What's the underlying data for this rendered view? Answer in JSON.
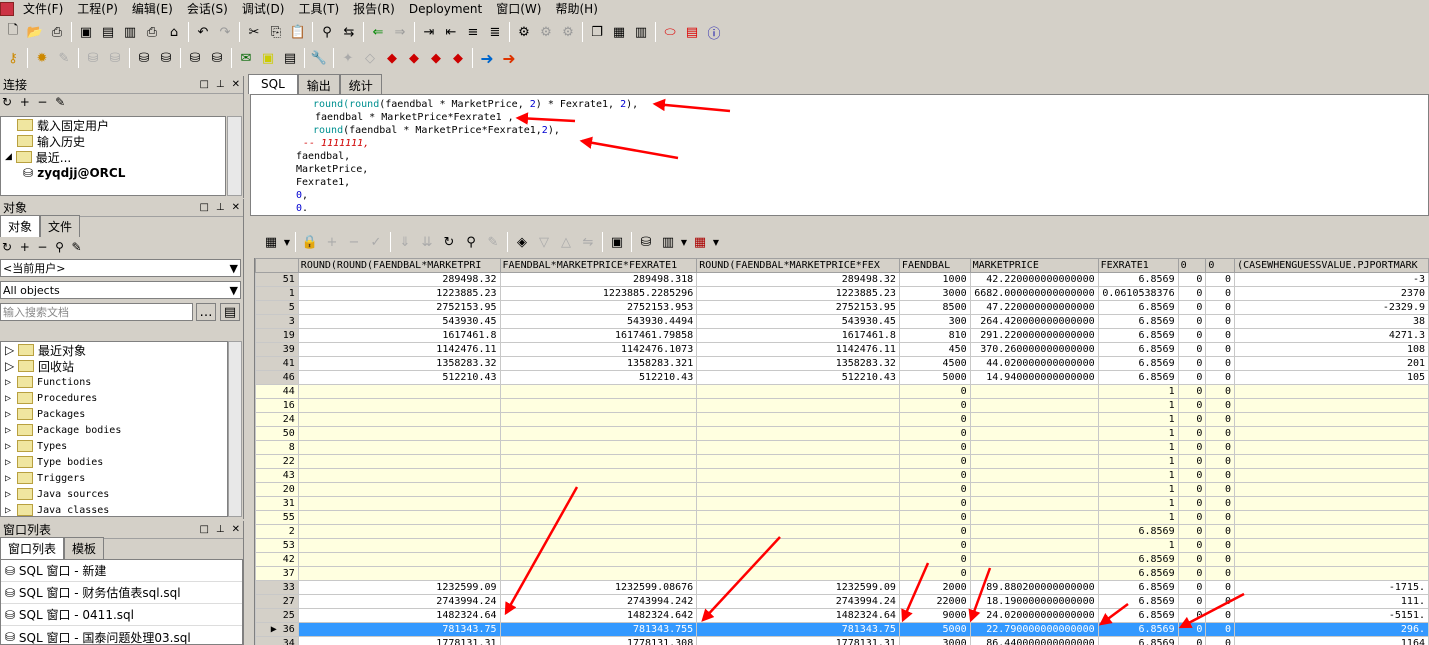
{
  "menu": [
    "文件(F)",
    "工程(P)",
    "编辑(E)",
    "会话(S)",
    "调试(D)",
    "工具(T)",
    "报告(R)",
    "Deployment",
    "窗口(W)",
    "帮助(H)"
  ],
  "connection": {
    "title": "连接",
    "items": [
      "载入固定用户",
      "输入历史",
      "最近...",
      "zyqdjj@ORCL"
    ]
  },
  "objects": {
    "title": "对象",
    "tabs": [
      "对象",
      "文件"
    ],
    "user_select": "<当前用户>",
    "filter_select": "All objects",
    "search_placeholder": "输入搜索文档",
    "items": [
      "最近对象",
      "回收站",
      "Functions",
      "Procedures",
      "Packages",
      "Package bodies",
      "Types",
      "Type bodies",
      "Triggers",
      "Java sources",
      "Java classes"
    ]
  },
  "windows": {
    "title": "窗口列表",
    "tabs": [
      "窗口列表",
      "模板"
    ],
    "items": [
      "SQL 窗口 - 新建",
      "SQL 窗口 - 财务估值表sql.sql",
      "SQL 窗口 - 0411.sql",
      "SQL 窗口 - 国泰问题处理03.sql"
    ]
  },
  "editor": {
    "tabs": [
      "SQL",
      "输出",
      "统计"
    ],
    "lines": [
      {
        "indent": "         ",
        "fn": "round(round",
        "rest": "(faendbal * MarketPrice, ",
        "n1": "2",
        "mid": ") * Fexrate1, ",
        "n2": "2",
        "end": "),"
      },
      {
        "indent": "         ",
        "fn": "",
        "rest": "faendbal * MarketPrice*Fexrate1 ,",
        "n1": "",
        "mid": "",
        "n2": "",
        "end": ""
      },
      {
        "indent": "         ",
        "fn": "round",
        "rest": "(faendbal * MarketPrice*Fexrate1,",
        "n1": "2",
        "mid": "),",
        "n2": "",
        "end": ""
      },
      {
        "indent": "      ",
        "comment": "-- 1111111,"
      },
      {
        "indent": "     ",
        "fn": "",
        "rest": "faendbal,",
        "n1": "",
        "mid": "",
        "n2": "",
        "end": ""
      },
      {
        "indent": "     ",
        "fn": "",
        "rest": "MarketPrice,",
        "n1": "",
        "mid": "",
        "n2": "",
        "end": ""
      },
      {
        "indent": "     ",
        "fn": "",
        "rest": "Fexrate1,",
        "n1": "",
        "mid": "",
        "n2": "",
        "end": ""
      },
      {
        "indent": "     ",
        "fn": "",
        "rest": "",
        "n1": "0",
        "mid": ",",
        "n2": "",
        "end": ""
      },
      {
        "indent": "     ",
        "fn": "",
        "rest": "",
        "n1": "0",
        "mid": ".",
        "n2": "",
        "end": ""
      }
    ]
  },
  "grid": {
    "columns": [
      "",
      "ROUND(ROUND(FAENDBAL*MARKETPRI",
      "FAENDBAL*MARKETPRICE*FEXRATE1",
      "ROUND(FAENDBAL*MARKETPRICE*FEX",
      "FAENDBAL",
      "MARKETPRICE",
      "FEXRATE1",
      "0",
      "0",
      "(CASEWHENGUESSVALUE.PJPORTMARK"
    ],
    "rows": [
      [
        "51",
        "289498.32",
        "289498.318",
        "289498.32",
        "1000",
        "42.220000000000000",
        "6.8569",
        "0",
        "0",
        "-3"
      ],
      [
        "1",
        "1223885.23",
        "1223885.2285296",
        "1223885.23",
        "3000",
        "6682.000000000000000",
        "0.0610538376",
        "0",
        "0",
        "2370"
      ],
      [
        "5",
        "2752153.95",
        "2752153.953",
        "2752153.95",
        "8500",
        "47.220000000000000",
        "6.8569",
        "0",
        "0",
        "-2329.9"
      ],
      [
        "3",
        "543930.45",
        "543930.4494",
        "543930.45",
        "300",
        "264.420000000000000",
        "6.8569",
        "0",
        "0",
        "38"
      ],
      [
        "19",
        "1617461.8",
        "1617461.79858",
        "1617461.8",
        "810",
        "291.220000000000000",
        "6.8569",
        "0",
        "0",
        "4271.3"
      ],
      [
        "39",
        "1142476.11",
        "1142476.1073",
        "1142476.11",
        "450",
        "370.260000000000000",
        "6.8569",
        "0",
        "0",
        "108"
      ],
      [
        "41",
        "1358283.32",
        "1358283.321",
        "1358283.32",
        "4500",
        "44.020000000000000",
        "6.8569",
        "0",
        "0",
        "201"
      ],
      [
        "46",
        "512210.43",
        "512210.43",
        "512210.43",
        "5000",
        "14.940000000000000",
        "6.8569",
        "0",
        "0",
        "105"
      ],
      [
        "44",
        "",
        "",
        "",
        "0",
        "",
        "1",
        "0",
        "0",
        ""
      ],
      [
        "16",
        "",
        "",
        "",
        "0",
        "",
        "1",
        "0",
        "0",
        ""
      ],
      [
        "24",
        "",
        "",
        "",
        "0",
        "",
        "1",
        "0",
        "0",
        ""
      ],
      [
        "50",
        "",
        "",
        "",
        "0",
        "",
        "1",
        "0",
        "0",
        ""
      ],
      [
        "8",
        "",
        "",
        "",
        "0",
        "",
        "1",
        "0",
        "0",
        ""
      ],
      [
        "22",
        "",
        "",
        "",
        "0",
        "",
        "1",
        "0",
        "0",
        ""
      ],
      [
        "43",
        "",
        "",
        "",
        "0",
        "",
        "1",
        "0",
        "0",
        ""
      ],
      [
        "20",
        "",
        "",
        "",
        "0",
        "",
        "1",
        "0",
        "0",
        ""
      ],
      [
        "31",
        "",
        "",
        "",
        "0",
        "",
        "1",
        "0",
        "0",
        ""
      ],
      [
        "55",
        "",
        "",
        "",
        "0",
        "",
        "1",
        "0",
        "0",
        ""
      ],
      [
        "2",
        "",
        "",
        "",
        "0",
        "",
        "6.8569",
        "0",
        "0",
        ""
      ],
      [
        "53",
        "",
        "",
        "",
        "0",
        "",
        "1",
        "0",
        "0",
        ""
      ],
      [
        "42",
        "",
        "",
        "",
        "0",
        "",
        "6.8569",
        "0",
        "0",
        ""
      ],
      [
        "37",
        "",
        "",
        "",
        "0",
        "",
        "6.8569",
        "0",
        "0",
        ""
      ],
      [
        "33",
        "1232599.09",
        "1232599.08676",
        "1232599.09",
        "2000",
        "89.880200000000000",
        "6.8569",
        "0",
        "0",
        "-1715."
      ],
      [
        "27",
        "2743994.24",
        "2743994.242",
        "2743994.24",
        "22000",
        "18.190000000000000",
        "6.8569",
        "0",
        "0",
        "111."
      ],
      [
        "25",
        "1482324.64",
        "1482324.642",
        "1482324.64",
        "9000",
        "24.020000000000000",
        "6.8569",
        "0",
        "0",
        "-5151."
      ],
      [
        "36",
        "781343.75",
        "781343.755",
        "781343.75",
        "5000",
        "22.790000000000000",
        "6.8569",
        "0",
        "0",
        "296."
      ],
      [
        "34",
        "1778131.31",
        "1778131.308",
        "1778131.31",
        "3000",
        "86.440000000000000",
        "6.8569",
        "0",
        "0",
        "1164"
      ]
    ]
  }
}
